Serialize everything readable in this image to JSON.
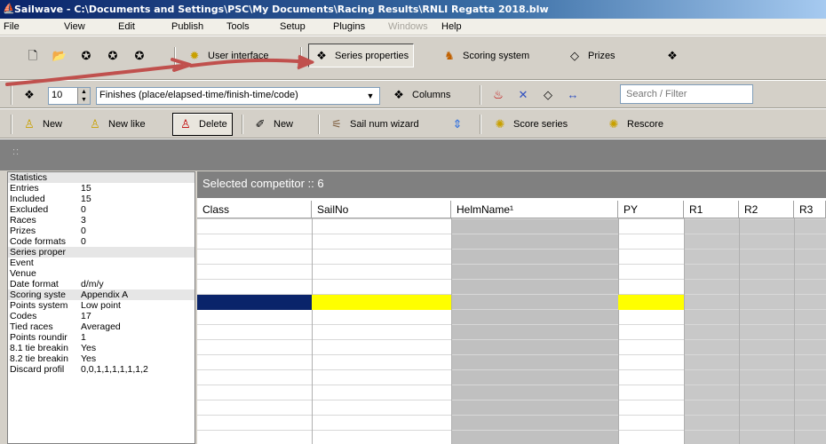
{
  "window": {
    "title": "Sailwave - C:\\Documents and Settings\\PSC\\My Documents\\Racing Results\\RNLI Regatta 2018.blw"
  },
  "menu": [
    {
      "id": "file",
      "label": "File",
      "enabled": true
    },
    {
      "id": "view",
      "label": "View",
      "enabled": true
    },
    {
      "id": "edit",
      "label": "Edit",
      "enabled": true
    },
    {
      "id": "publish",
      "label": "Publish",
      "enabled": true
    },
    {
      "id": "tools",
      "label": "Tools",
      "enabled": true
    },
    {
      "id": "setup",
      "label": "Setup",
      "enabled": true
    },
    {
      "id": "plugins",
      "label": "Plugins",
      "enabled": true
    },
    {
      "id": "windows",
      "label": "Windows",
      "enabled": false
    },
    {
      "id": "help",
      "label": "Help",
      "enabled": true
    }
  ],
  "toolbar1": {
    "user_interface_label": "User interface",
    "series_properties_label": "Series properties",
    "scoring_system_label": "Scoring system",
    "prizes_label": "Prizes"
  },
  "toolbar2": {
    "spinner_value": "10",
    "view_mode_value": "Finishes (place/elapsed-time/finish-time/code)",
    "columns_label": "Columns",
    "search_placeholder": "Search / Filter"
  },
  "toolbar3": {
    "new_label": "New",
    "new_like_label": "New like",
    "delete_label": "Delete",
    "new_race_label": "New",
    "sail_num_wizard_label": "Sail num wizard",
    "score_series_label": "Score series",
    "rescore_label": "Rescore"
  },
  "statusbar": {
    "dots": "::"
  },
  "stats": [
    {
      "key": "Statistics",
      "value": "",
      "header": true
    },
    {
      "key": "Entries",
      "value": "15"
    },
    {
      "key": "Included",
      "value": "15"
    },
    {
      "key": "Excluded",
      "value": "0"
    },
    {
      "key": "Races",
      "value": "3"
    },
    {
      "key": "Prizes",
      "value": "0"
    },
    {
      "key": "Code formats",
      "value": "0"
    },
    {
      "key": "Series proper",
      "value": "",
      "header": true
    },
    {
      "key": "Event",
      "value": ""
    },
    {
      "key": "Venue",
      "value": ""
    },
    {
      "key": "Date format",
      "value": "d/m/y"
    },
    {
      "key": "Scoring syste",
      "value": "Appendix A",
      "header": true
    },
    {
      "key": "Points system",
      "value": "Low point"
    },
    {
      "key": "Codes",
      "value": "17"
    },
    {
      "key": "Tied races",
      "value": "Averaged"
    },
    {
      "key": "Points roundir",
      "value": "1"
    },
    {
      "key": "8.1 tie breakin",
      "value": "Yes"
    },
    {
      "key": "8.2 tie breakin",
      "value": "Yes"
    },
    {
      "key": "Discard profil",
      "value": "0,0,1,1,1,1,1,1,2"
    }
  ],
  "grid": {
    "selected_label": "Selected competitor :: 6",
    "columns": [
      "Class",
      "SailNo",
      "HelmName¹",
      "PY",
      "R1",
      "R2",
      "R3"
    ],
    "selected_row_index": 5,
    "colors": {
      "selected_class": "#0a246a",
      "selected_yellow": "#ffff00",
      "shaded_column": "#c0c0c0"
    }
  }
}
